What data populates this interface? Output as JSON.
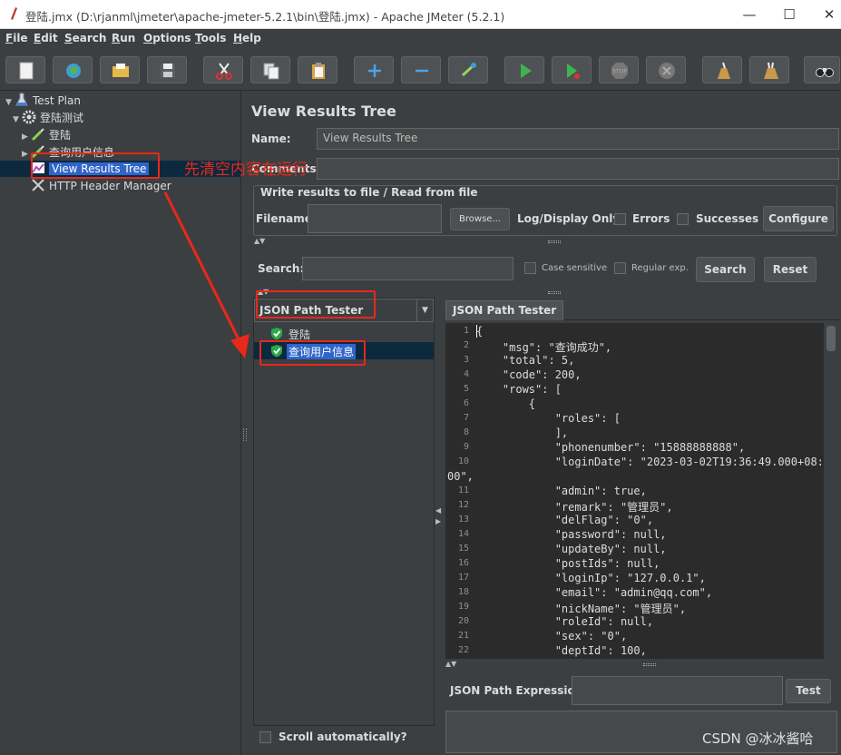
{
  "window": {
    "title": "登陆.jmx (D:\\rjanml\\jmeter\\apache-jmeter-5.2.1\\bin\\登陆.jmx) - Apache JMeter (5.2.1)",
    "minimize": "—",
    "maximize": "☐",
    "close": "✕"
  },
  "menu": [
    "File",
    "Edit",
    "Search",
    "Run",
    "Options",
    "Tools",
    "Help"
  ],
  "toolbar": [
    "new-icon",
    "templates-icon",
    "open-icon",
    "save-icon",
    "cut-icon",
    "copy-icon",
    "paste-icon",
    "expand-icon",
    "collapse-icon",
    "toggle-icon",
    "start-icon",
    "start-no-pause-icon",
    "stop-icon",
    "shutdown-icon",
    "clear-icon",
    "clear-all-icon",
    "search-binoculars-icon"
  ],
  "tree": {
    "test_plan": "Test Plan",
    "thread_group": "登陆测试",
    "login": "登陆",
    "query_user": "查询用户信息",
    "view_results_tree": "View Results Tree",
    "header_manager": "HTTP Header Manager"
  },
  "panel": {
    "heading": "View Results Tree",
    "name_label": "Name:",
    "name_value": "View Results Tree",
    "comments_label": "Comments",
    "file_group_label": "Write results to file / Read from file",
    "filename_label": "Filename",
    "browse": "Browse...",
    "log_display_only": "Log/Display Only:",
    "errors": "Errors",
    "successes": "Successes",
    "configure": "Configure",
    "search_label": "Search:",
    "case_sensitive": "Case sensitive",
    "regular_exp": "Regular exp.",
    "search_button": "Search",
    "reset_button": "Reset",
    "renderer_selected": "JSON Path Tester",
    "results": [
      "登陆",
      "查询用户信息"
    ],
    "tab_label": "JSON Path Tester",
    "json_path_label": "JSON Path Expression",
    "test_button": "Test",
    "scroll_auto": "Scroll automatically?"
  },
  "json_lines": [
    {
      "n": "1",
      "text": "{"
    },
    {
      "n": "2",
      "text": "    \"msg\": \"查询成功\","
    },
    {
      "n": "3",
      "text": "    \"total\": 5,"
    },
    {
      "n": "4",
      "text": "    \"code\": 200,"
    },
    {
      "n": "5",
      "text": "    \"rows\": ["
    },
    {
      "n": "6",
      "text": "        {"
    },
    {
      "n": "7",
      "text": "            \"roles\": ["
    },
    {
      "n": "8",
      "text": "            ],"
    },
    {
      "n": "9",
      "text": "            \"phonenumber\": \"15888888888\","
    },
    {
      "n": "10",
      "text": "            \"loginDate\": \"2023-03-02T19:36:49.000+08:"
    },
    {
      "n": "",
      "text": "00\","
    },
    {
      "n": "11",
      "text": "            \"admin\": true,"
    },
    {
      "n": "12",
      "text": "            \"remark\": \"管理员\","
    },
    {
      "n": "13",
      "text": "            \"delFlag\": \"0\","
    },
    {
      "n": "14",
      "text": "            \"password\": null,"
    },
    {
      "n": "15",
      "text": "            \"updateBy\": null,"
    },
    {
      "n": "16",
      "text": "            \"postIds\": null,"
    },
    {
      "n": "17",
      "text": "            \"loginIp\": \"127.0.0.1\","
    },
    {
      "n": "18",
      "text": "            \"email\": \"admin@qq.com\","
    },
    {
      "n": "19",
      "text": "            \"nickName\": \"管理员\","
    },
    {
      "n": "20",
      "text": "            \"roleId\": null,"
    },
    {
      "n": "21",
      "text": "            \"sex\": \"0\","
    },
    {
      "n": "22",
      "text": "            \"deptId\": 100,"
    }
  ],
  "annotation": {
    "note": "先清空内容在运行",
    "color": "#e8281a"
  },
  "watermark": "CSDN @冰冰酱哈"
}
